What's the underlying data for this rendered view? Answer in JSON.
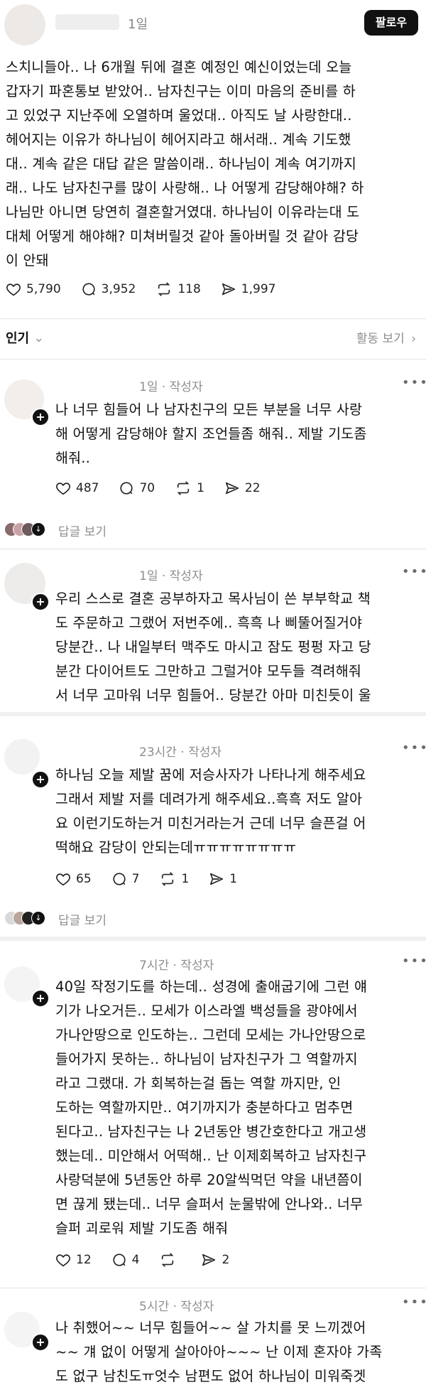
{
  "header": {
    "time": "1일",
    "follow_label": "팔로우"
  },
  "post": {
    "text": "스치니들아.. 나 6개월 뒤에 결혼 예정인 예신이었는데 오늘\n갑자기 파혼통보 받았어.. 남자친구는 이미 마음의 준비를 하\n고 있었구 지난주에 오열하며 울었대.. 아직도 날 사랑한대..\n헤어지는 이유가 하나님이 헤어지라고 해서래.. 계속 기도했\n대.. 계속 같은 대답 같은 말씀이래.. 하나님이 계속 여기까지\n래.. 나도 남자친구를 많이 사랑해.. 나 어떻게 감당해야해? 하\n나님만 아니면 당연히 결혼할거였대. 하나님이 이유라는대 도\n대체 어떻게 해야해? 미쳐버릴것 같아 돌아버릴 것 같아 감당\n이 안돼",
    "likes": "5,790",
    "comments": "3,952",
    "reposts": "118",
    "shares": "1,997"
  },
  "sort": {
    "label": "인기",
    "activity_label": "활동 보기"
  },
  "replies": [
    {
      "time": "1일 · 작성자",
      "text": "나 너무 힘들어 나 남자친구의 모든 부분을 너무 사랑\n해 어떻게 감당해야 할지 조언들좀 해줘.. 제발 기도좀\n해줘..",
      "likes": "487",
      "comments": "70",
      "reposts": "1",
      "shares": "22",
      "view_replies": "답글 보기"
    },
    {
      "time": "1일 · 작성자",
      "text": "우리 스스로 결혼 공부하자고 목사님이 쓴 부부학교 책\n도 주문하고 그랬어 저번주에.. 흑흑 나 삐뚤어질거야\n당분간.. 나 내일부터 맥주도 마시고 잠도 펑펑 자고 당\n분간 다이어트도 그만하고 그럴거야 모두들 격려해줘\n서 너무 고마워 너무 힘들어.. 당분간 아마 미친듯이 울"
    },
    {
      "time": "23시간 · 작성자",
      "text": "하나님 오늘 제발 꿈에 저승사자가 나타나게 해주세요\n그래서 제발 저를 데려가게 해주세요..흑흑 저도 알아\n요 이런기도하는거 미친거라는거 근데 너무 슬픈걸 어\n떡해요 감당이 안되는데ㅠㅠㅠㅠㅠㅠㅠㅠ",
      "likes": "65",
      "comments": "7",
      "reposts": "1",
      "shares": "1",
      "view_replies": "답글 보기"
    },
    {
      "time": "7시간 · 작성자",
      "text": "40일 작정기도를 하는데.. 성경에 출애굽기에 그런 얘\n기가 나오거든.. 모세가 이스라엘 백성들을 광야에서\n가나안땅으로 인도하는.. 그런데 모세는 가나안땅으로\n들어가지 못하는.. 하나님이 남자친구가 그 역할까지\n라고 그랬대.     가 회복하는걸 돕는 역할 까지만, 인\n도하는 역할까지만.. 여기까지가 충분하다고 멈추면\n된다고.. 남자친구는 나 2년동안 병간호한다고 개고생\n했는데.. 미안해서 어떡해.. 난 이제회복하고 남자친구\n사랑덕분에 5년동안 하루 20알씩먹던 약을 내년쯤이\n면 끊게 됐는데.. 너무 슬퍼서 눈물밖에 안나와.. 너무\n슬퍼 괴로워 제발 기도좀 해줘",
      "likes": "12",
      "comments": "4",
      "shares": "2"
    },
    {
      "time": "5시간 · 작성자",
      "text": "나 취했어~~ 너무 힘들어~~ 살 가치를 못 느끼겠어\n~~ 걔 없이 어떻게 살아아아~~~ 난 이제 혼자야 가족\n도 없구 남친도ㅠ엇수 남편도 없어 하나님이 미워죽겟"
    }
  ],
  "icons": {
    "like": "heart-icon",
    "comment": "speech-bubble-icon",
    "repost": "repost-arrows-icon",
    "share": "send-arrow-icon",
    "more": "more-dots-icon",
    "follow_plus": "plus-icon"
  }
}
